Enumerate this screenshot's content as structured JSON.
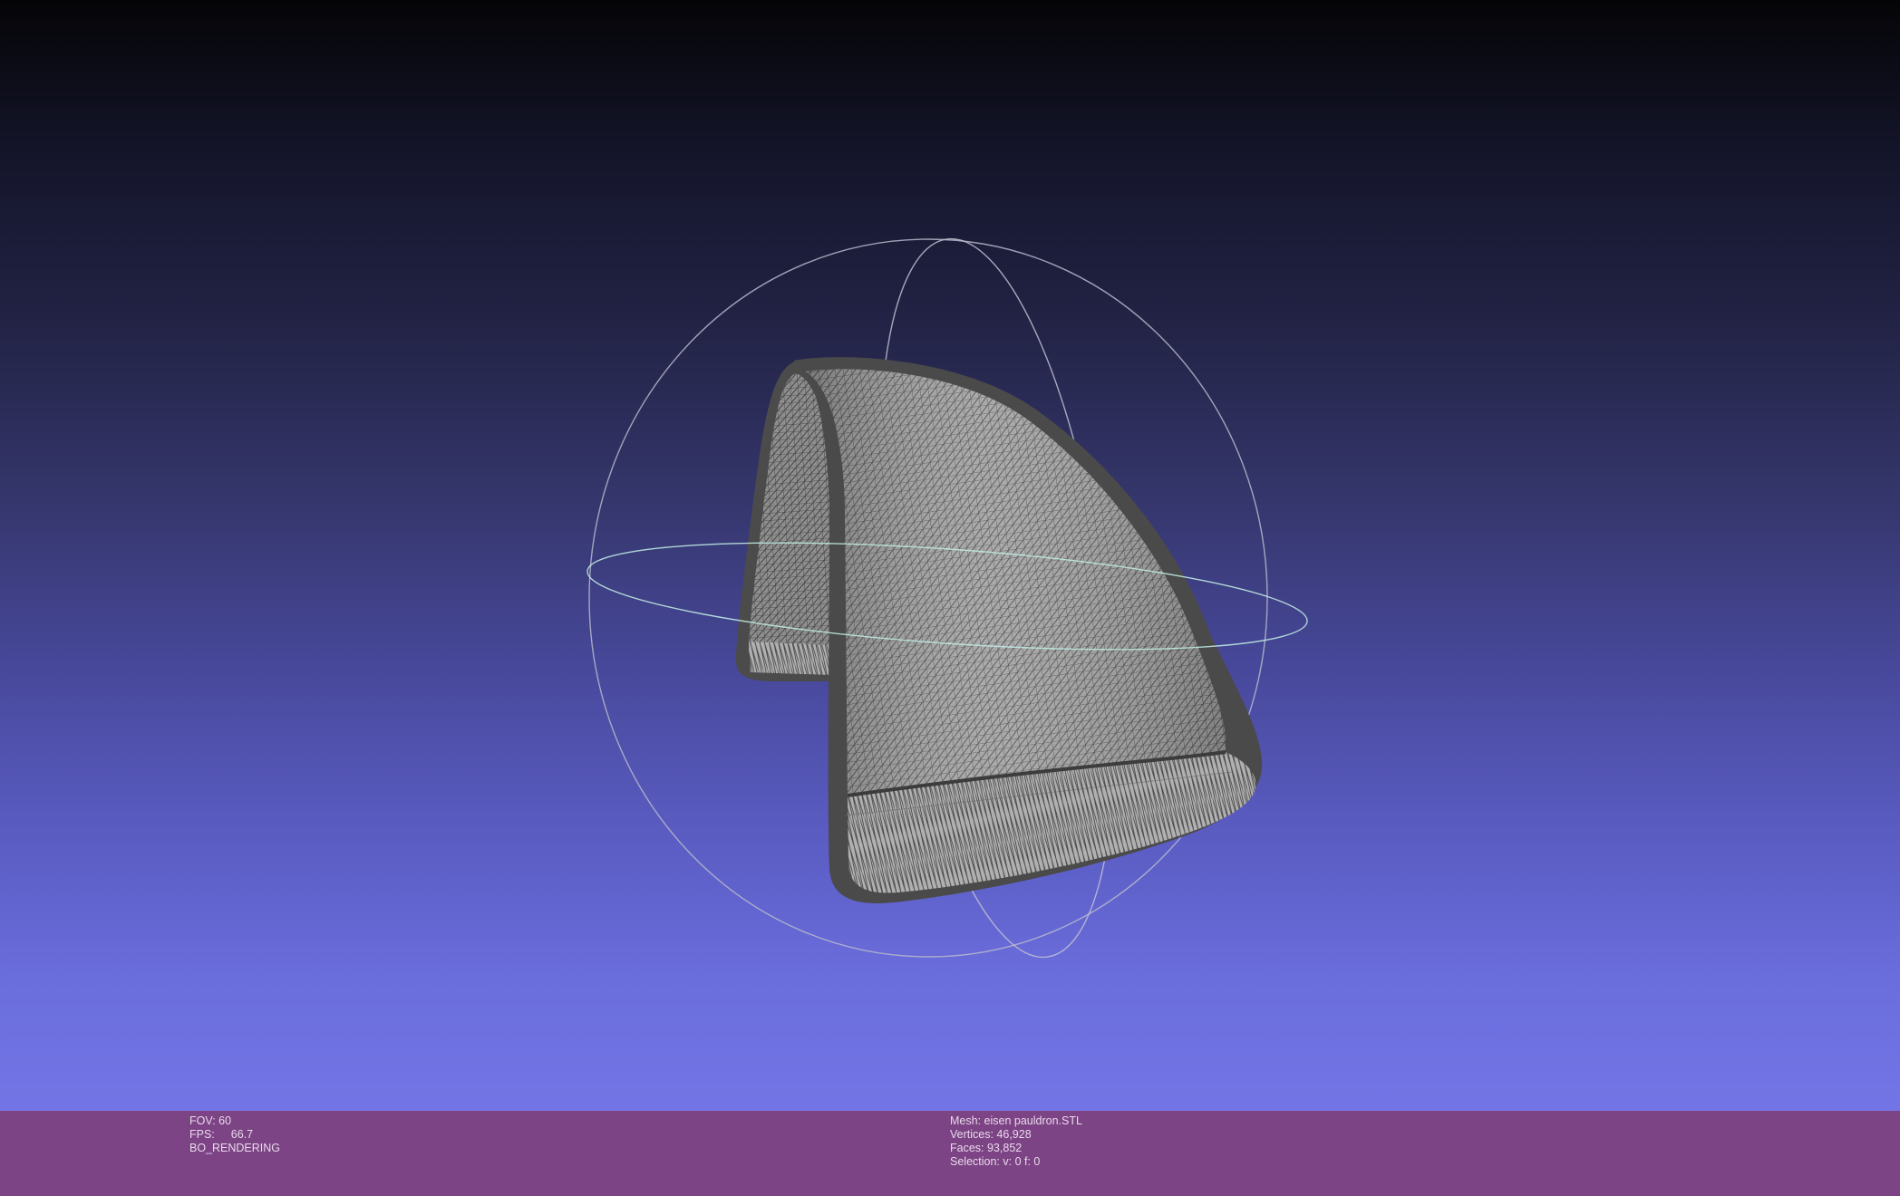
{
  "app": {
    "window": "MeshLab 3D viewport"
  },
  "viewport": {
    "background_top": "#050507",
    "background_bottom": "#7375e6",
    "mesh_fill": "#9a9a9a",
    "mesh_wire": "#3a3a3a",
    "mesh_border": "#4a4a4a",
    "trackball_color": "#c6c6d6",
    "trackball_equator_color": "#bfe8e0"
  },
  "info_bar": {
    "background": "#7c4484",
    "left": {
      "fov": "FOV: 60",
      "fps_label": "FPS:",
      "fps_value": "66.7",
      "render_mode": "BO_RENDERING"
    },
    "right": {
      "mesh": "Mesh: eisen pauldron.STL",
      "vertices": "Vertices: 46,928",
      "faces": "Faces: 93,852",
      "selection": "Selection: v: 0 f: 0"
    }
  }
}
